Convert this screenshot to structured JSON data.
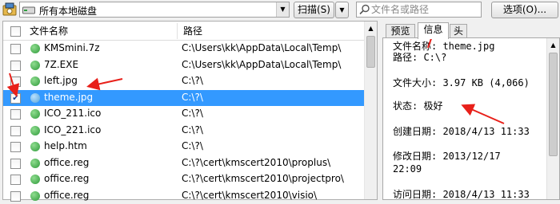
{
  "toolbar": {
    "drive_select": "所有本地磁盘",
    "scan_label": "扫描(S)",
    "search_placeholder": "文件名或路径",
    "options_label": "选项(O)..."
  },
  "list": {
    "columns": [
      "文件名称",
      "路径"
    ],
    "rows": [
      {
        "name": "KMSmini.7z",
        "path": "C:\\Users\\kk\\AppData\\Local\\Temp\\",
        "checked": false,
        "selected": false
      },
      {
        "name": "7Z.EXE",
        "path": "C:\\Users\\kk\\AppData\\Local\\Temp\\",
        "checked": false,
        "selected": false
      },
      {
        "name": "left.jpg",
        "path": "C:\\?\\",
        "checked": false,
        "selected": false
      },
      {
        "name": "theme.jpg",
        "path": "C:\\?\\",
        "checked": true,
        "selected": true
      },
      {
        "name": "ICO_211.ico",
        "path": "C:\\?\\",
        "checked": false,
        "selected": false
      },
      {
        "name": "ICO_221.ico",
        "path": "C:\\?\\",
        "checked": false,
        "selected": false
      },
      {
        "name": "help.htm",
        "path": "C:\\?\\",
        "checked": false,
        "selected": false
      },
      {
        "name": "office.reg",
        "path": "C:\\?\\cert\\kmscert2010\\proplus\\",
        "checked": false,
        "selected": false
      },
      {
        "name": "office.reg",
        "path": "C:\\?\\cert\\kmscert2010\\projectpro\\",
        "checked": false,
        "selected": false
      },
      {
        "name": "office.reg",
        "path": "C:\\?\\cert\\kmscert2010\\visio\\",
        "checked": false,
        "selected": false
      }
    ]
  },
  "preview": {
    "tabs": [
      "预览",
      "信息",
      "头"
    ],
    "active_tab": 1,
    "lines": [
      "文件名称: theme.jpg",
      "路径: C:\\?",
      "",
      "文件大小: 3.97 KB (4,066)",
      "",
      "状态: 极好",
      "",
      "创建日期: 2018/4/13 11:33",
      "",
      "修改日期: 2013/12/17",
      "22:09",
      "",
      "访问日期: 2018/4/13 11:33"
    ]
  },
  "colors": {
    "selection": "#3399ff",
    "file_icon": "#4cae4c",
    "annotation": "#e8201a"
  },
  "icons": {
    "app": "recovery-app-icon",
    "drive": "drive-icon",
    "search": "search-filter-icon",
    "file": "green-circle-file-icon"
  }
}
